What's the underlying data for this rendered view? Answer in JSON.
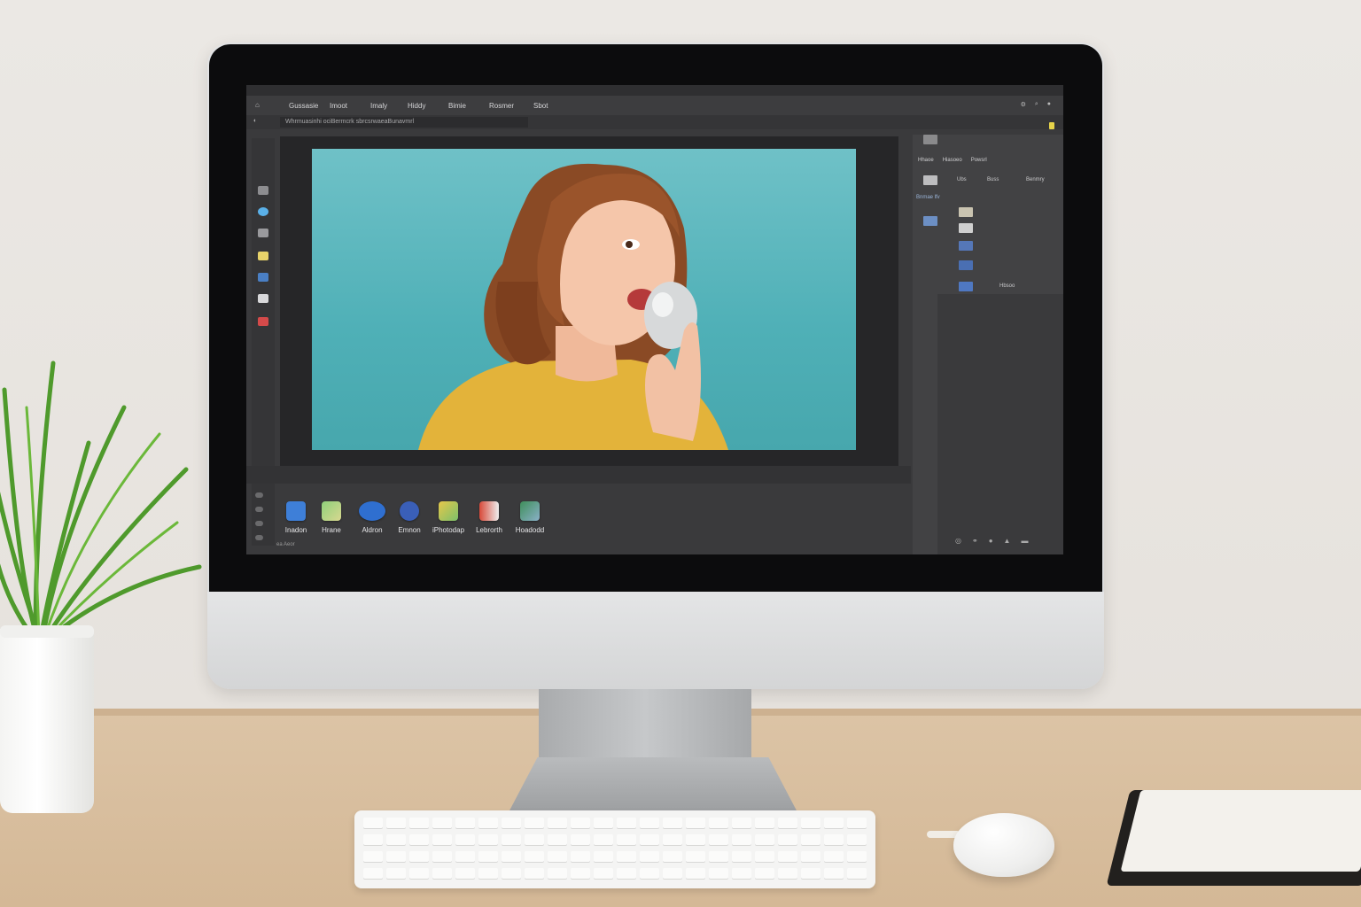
{
  "editor": {
    "menubar_text": "",
    "toolbar": {
      "items": [
        "Gussasie",
        "Imoot",
        "Imaly",
        "Hiddy",
        "Bimie",
        "Rosmer",
        "Sbot"
      ]
    },
    "options_path": "Whrmuasinhi ociBermcrk sbrcsrwaeaBunavmrl",
    "panel": {
      "tabs": [
        "Hhaoe",
        "Hiasoeo",
        "Powsrl"
      ],
      "rows": [
        "Ubs",
        "Buss",
        "Benmry"
      ],
      "layers_header": "Bnmae lfv",
      "layer_label": "Hbsoo"
    },
    "dock": {
      "items": [
        {
          "label": "Inadon",
          "icon": "blue-square-icon"
        },
        {
          "label": "Hrane",
          "icon": "green-square-icon"
        },
        {
          "label": "Aldron",
          "icon": "cloud-icon"
        },
        {
          "label": "Emnon",
          "icon": "globe-icon"
        },
        {
          "label": "iPhotodap",
          "icon": "photo-folder-icon"
        },
        {
          "label": "Lebrorth",
          "icon": "red-document-icon"
        },
        {
          "label": "Hoadodd",
          "icon": "tool-icon"
        }
      ]
    },
    "status": "ea Aeor"
  },
  "colors": {
    "artboard_bg": "#52b2b8",
    "editor_bg": "#3a3a3c",
    "accent_yellow": "#e6d34a"
  }
}
